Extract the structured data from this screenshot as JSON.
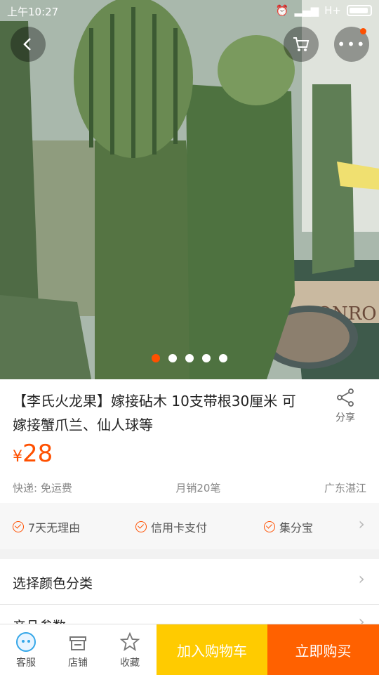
{
  "status": {
    "time": "上午10:27",
    "network": "H+"
  },
  "gallery": {
    "total": 5,
    "active_index": 0,
    "pot_text": "MONRO"
  },
  "product": {
    "title": "【李氏火龙果】嫁接砧木 10支带根30厘米 可嫁接蟹爪兰、仙人球等",
    "share_label": "分享",
    "currency": "¥",
    "price": "28",
    "shipping": "快递: 免运费",
    "monthly_sales": "月销20笔",
    "location": "广东湛江"
  },
  "services": [
    {
      "label": "7天无理由"
    },
    {
      "label": "信用卡支付"
    },
    {
      "label": "集分宝"
    }
  ],
  "rows": {
    "select_label": "选择颜色分类",
    "params_label": "产品参数"
  },
  "bottom": {
    "service_label": "客服",
    "shop_label": "店铺",
    "fav_label": "收藏",
    "cart_label": "加入购物车",
    "buy_label": "立即购买"
  },
  "colors": {
    "accent": "#ff5000",
    "cart": "#ffcb00",
    "buy": "#ff6100"
  }
}
